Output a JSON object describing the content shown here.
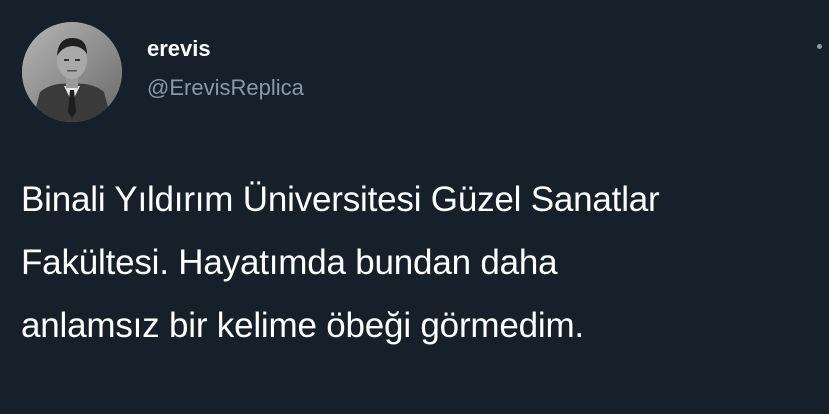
{
  "colors": {
    "background": "#15202b",
    "text_primary": "#ffffff",
    "text_secondary": "#8899a6"
  },
  "author": {
    "display_name": "erevis",
    "handle": "@ErevisReplica",
    "avatar_icon": "profile-photo"
  },
  "menu": {
    "icon": "more-options-icon"
  },
  "tweet": {
    "lines": [
      "Binali Yıldırım Üniversitesi Güzel Sanatlar",
      "Fakültesi. Hayatımda bundan daha",
      "anlamsız bir kelime öbeği görmedim."
    ]
  }
}
